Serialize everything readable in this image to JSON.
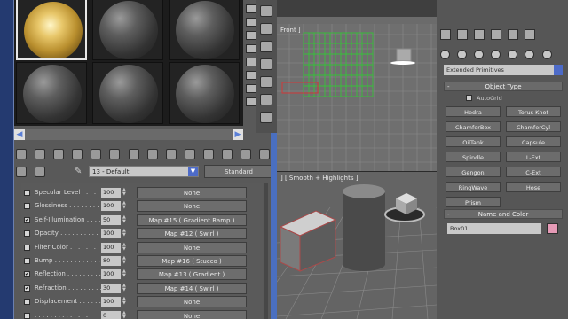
{
  "colors": {
    "selection_blue": "#4a6fc0",
    "swatch_pink": "#e59ab6",
    "grid_green": "#37c23a",
    "grid_red": "#d23a3a"
  },
  "material_editor": {
    "slots_count": 9,
    "active_slot": 0,
    "material_name": "13 - Default",
    "material_type": "Standard",
    "maps": [
      {
        "label": "Specular Level . . . . . .",
        "checked": false,
        "amount": "100",
        "map": "None"
      },
      {
        "label": "Glossiness . . . . . . . .",
        "checked": false,
        "amount": "100",
        "map": "None"
      },
      {
        "label": "Self-Illumination . . . .",
        "checked": true,
        "amount": "50",
        "map": "Map #15 ( Gradient Ramp )"
      },
      {
        "label": "Opacity . . . . . . . . . .",
        "checked": false,
        "amount": "100",
        "map": "Map #12 ( Swirl )"
      },
      {
        "label": "Filter Color . . . . . . . .",
        "checked": false,
        "amount": "100",
        "map": "None"
      },
      {
        "label": "Bump . . . . . . . . . . . .",
        "checked": false,
        "amount": "80",
        "map": "Map #16 ( Stucco )"
      },
      {
        "label": "Reflection . . . . . . . . .",
        "checked": true,
        "amount": "100",
        "map": "Map #13 ( Gradient )"
      },
      {
        "label": "Refraction . . . . . . . . .",
        "checked": true,
        "amount": "30",
        "map": "Map #14 ( Swirl )"
      },
      {
        "label": "Displacement . . . . . . .",
        "checked": false,
        "amount": "100",
        "map": "None"
      },
      {
        "label": ". . . . . . . . . . . . . .",
        "checked": false,
        "amount": "0",
        "map": "None"
      }
    ]
  },
  "viewports": {
    "top_label": "Front ]",
    "persp_label": "] [ Smooth + Highlights ]"
  },
  "command_panel": {
    "category": "Extended Primitives",
    "object_type_title": "Object Type",
    "autogrid_label": "AutoGrid",
    "objects": [
      "Hedra",
      "Torus Knot",
      "ChamferBox",
      "ChamferCyl",
      "OilTank",
      "Capsule",
      "Spindle",
      "L-Ext",
      "Gengon",
      "C-Ext",
      "RingWave",
      "Hose",
      "Prism"
    ],
    "name_color_title": "Name and Color",
    "object_name": "Box01"
  }
}
